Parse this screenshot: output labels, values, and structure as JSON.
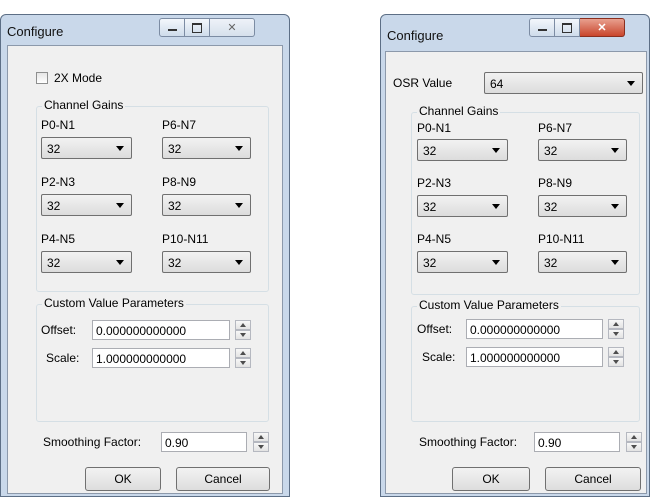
{
  "windows": [
    {
      "title": "Configure",
      "close_style": "inactive",
      "mode_label": "2X Mode",
      "mode_checked": false,
      "channel_gains": {
        "label": "Channel Gains",
        "channels": [
          {
            "name": "P0-N1",
            "value": "32"
          },
          {
            "name": "P6-N7",
            "value": "32"
          },
          {
            "name": "P2-N3",
            "value": "32"
          },
          {
            "name": "P8-N9",
            "value": "32"
          },
          {
            "name": "P4-N5",
            "value": "32"
          },
          {
            "name": "P10-N11",
            "value": "32"
          }
        ]
      },
      "custom": {
        "label": "Custom Value Parameters",
        "offset_label": "Offset:",
        "offset_value": "0.000000000000",
        "scale_label": "Scale:",
        "scale_value": "1.000000000000"
      },
      "smoothing": {
        "label": "Smoothing Factor:",
        "value": "0.90"
      },
      "ok_label": "OK",
      "cancel_label": "Cancel"
    },
    {
      "title": "Configure",
      "close_style": "active",
      "osr": {
        "label": "OSR Value",
        "value": "64"
      },
      "channel_gains": {
        "label": "Channel Gains",
        "channels": [
          {
            "name": "P0-N1",
            "value": "32"
          },
          {
            "name": "P6-N7",
            "value": "32"
          },
          {
            "name": "P2-N3",
            "value": "32"
          },
          {
            "name": "P8-N9",
            "value": "32"
          },
          {
            "name": "P4-N5",
            "value": "32"
          },
          {
            "name": "P10-N11",
            "value": "32"
          }
        ]
      },
      "custom": {
        "label": "Custom Value Parameters",
        "offset_label": "Offset:",
        "offset_value": "0.000000000000",
        "scale_label": "Scale:",
        "scale_value": "1.000000000000"
      },
      "smoothing": {
        "label": "Smoothing Factor:",
        "value": "0.90"
      },
      "ok_label": "OK",
      "cancel_label": "Cancel"
    }
  ],
  "colors": {
    "frame": "#c9d8ea",
    "client": "#f0f0f0",
    "close_active": "#c9462c"
  }
}
